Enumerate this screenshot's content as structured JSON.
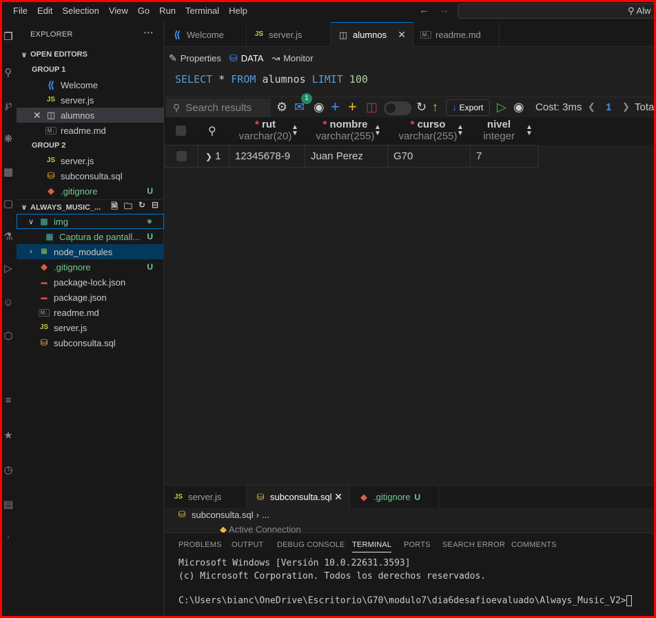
{
  "menu": [
    "File",
    "Edit",
    "Selection",
    "View",
    "Go",
    "Run",
    "Terminal",
    "Help"
  ],
  "command_center": {
    "text": "Alw"
  },
  "explorer": {
    "title": "EXPLORER",
    "open_editors": "OPEN EDITORS",
    "group1": "GROUP 1",
    "group1_items": [
      "Welcome",
      "server.js",
      "alumnos",
      "readme.md"
    ],
    "group2": "GROUP 2",
    "group2_items": [
      "server.js",
      "subconsulta.sql",
      ".gitignore"
    ],
    "git_untracked": "U",
    "project": "ALWAYS_MUSIC_...",
    "tree": {
      "img": "img",
      "captura": "Captura de pantall...",
      "node_modules": "node_modules",
      "gitignore": ".gitignore",
      "package_lock": "package-lock.json",
      "package": "package.json",
      "readme": "readme.md",
      "server": "server.js",
      "subconsulta": "subconsulta.sql"
    }
  },
  "tabs": [
    "Welcome",
    "server.js",
    "alumnos",
    "readme.md"
  ],
  "view_tabs": [
    "Properties",
    "DATA",
    "Monitor"
  ],
  "query": {
    "select": "SELECT",
    "star": "*",
    "from": "FROM",
    "table": "alumnos",
    "limit": "LIMIT",
    "count": "100"
  },
  "toolbar": {
    "search_placeholder": "Search results",
    "notification_count": "1",
    "export": "Export",
    "cost": "Cost: 3ms",
    "page": "1",
    "total": "Tota"
  },
  "columns": [
    {
      "name": "rut",
      "type": "varchar(20)",
      "required": true
    },
    {
      "name": "nombre",
      "type": "varchar(255)",
      "required": true
    },
    {
      "name": "curso",
      "type": "varchar(255)",
      "required": true
    },
    {
      "name": "nivel",
      "type": "integer",
      "required": false
    }
  ],
  "rows": [
    {
      "index": "1",
      "rut": "12345678-9",
      "nombre": "Juan Perez",
      "curso": "G70",
      "nivel": "7"
    }
  ],
  "bottom_tabs": [
    "server.js",
    "subconsulta.sql",
    ".gitignore"
  ],
  "breadcrumb": {
    "file": "subconsulta.sql",
    "rest": "..."
  },
  "active_connection": "Active Connection",
  "panel_tabs": [
    "PROBLEMS",
    "OUTPUT",
    "DEBUG CONSOLE",
    "TERMINAL",
    "PORTS",
    "SEARCH ERROR",
    "COMMENTS"
  ],
  "terminal": {
    "line1": "Microsoft Windows [Versión 10.0.22631.3593]",
    "line2": "(c) Microsoft Corporation. Todos los derechos reservados.",
    "prompt": "C:\\Users\\bianc\\OneDrive\\Escritorio\\G70\\modulo7\\dia6desafioevaluado\\Always_Music_V2>"
  },
  "colors": {
    "accent": "#0078d4",
    "untracked": "#73c991",
    "keyword": "#569cd6",
    "number": "#b5cea8",
    "required": "#f14c4c"
  }
}
